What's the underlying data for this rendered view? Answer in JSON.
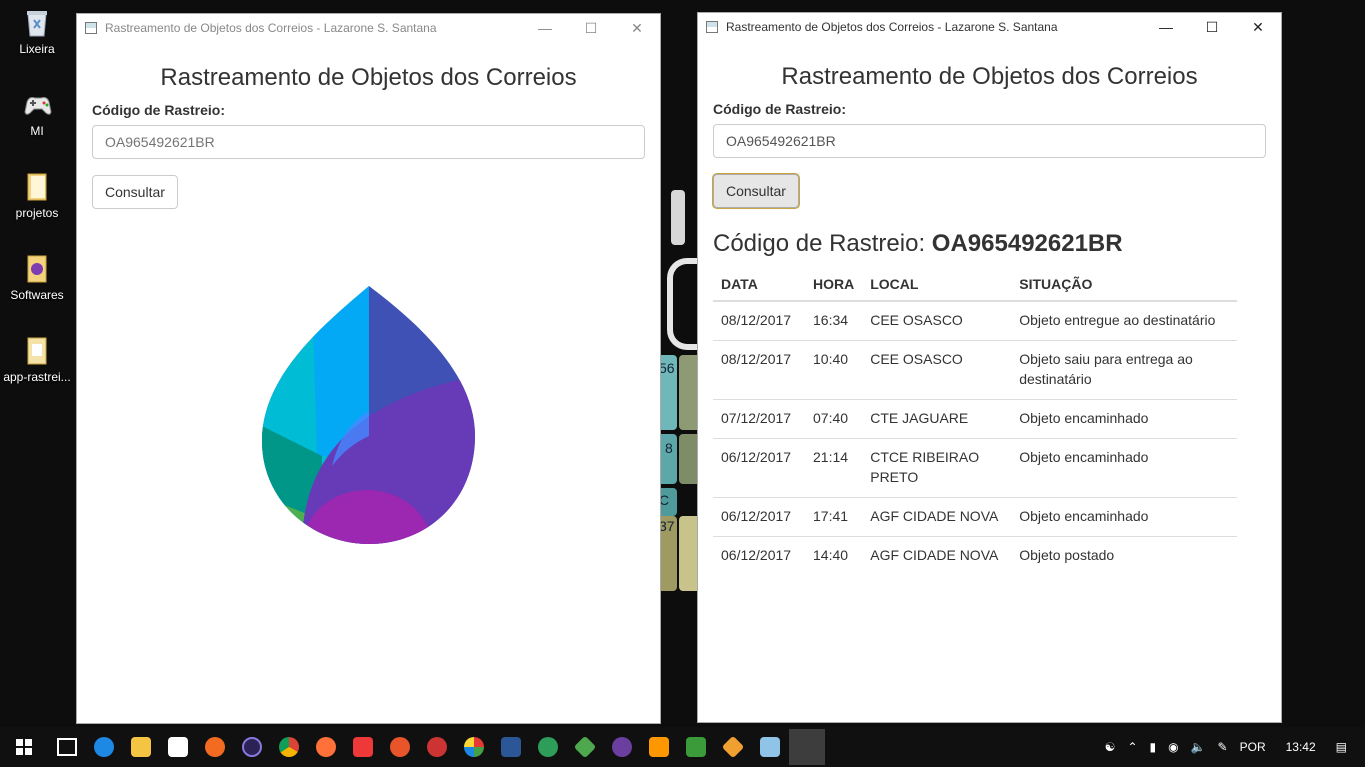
{
  "desktop": {
    "icons": [
      {
        "label": "Lixeira",
        "icon": "recycle-bin-icon"
      },
      {
        "label": "MI",
        "icon": "gamepad-icon"
      },
      {
        "label": "projetos",
        "icon": "folder-icon"
      },
      {
        "label": "Softwares",
        "icon": "folder-icon"
      },
      {
        "label": "app-rastrei...",
        "icon": "folder-icon"
      }
    ],
    "bg_text": [
      "56",
      "8",
      "C",
      "37"
    ]
  },
  "left_window": {
    "title": "Rastreamento de Objetos dos Correios - Lazarone S. Santana",
    "heading": "Rastreamento de Objetos dos Correios",
    "field_label": "Código de Rastreio:",
    "input_placeholder": "OA965492621BR",
    "button_label": "Consultar",
    "logo_icon": "drop-logo-icon"
  },
  "right_window": {
    "title": "Rastreamento de Objetos dos Correios - Lazarone S. Santana",
    "heading": "Rastreamento de Objetos dos Correios",
    "field_label": "Código de Rastreio:",
    "input_value": "OA965492621BR",
    "button_label": "Consultar",
    "result_prefix": "Código de Rastreio:",
    "result_code": "OA965492621BR",
    "table": {
      "headers": [
        "DATA",
        "HORA",
        "LOCAL",
        "SITUAÇÃO"
      ],
      "rows": [
        [
          "08/12/2017",
          "16:34",
          "CEE OSASCO",
          "Objeto entregue ao destinatário"
        ],
        [
          "08/12/2017",
          "10:40",
          "CEE OSASCO",
          "Objeto saiu para entrega ao destinatário"
        ],
        [
          "07/12/2017",
          "07:40",
          "CTE JAGUARE",
          "Objeto encaminhado"
        ],
        [
          "06/12/2017",
          "21:14",
          "CTCE RIBEIRAO PRETO",
          "Objeto encaminhado"
        ],
        [
          "06/12/2017",
          "17:41",
          "AGF CIDADE NOVA",
          "Objeto encaminhado"
        ],
        [
          "06/12/2017",
          "14:40",
          "AGF CIDADE NOVA",
          "Objeto postado"
        ]
      ]
    }
  },
  "taskbar": {
    "language": "POR",
    "time": "13:42"
  }
}
